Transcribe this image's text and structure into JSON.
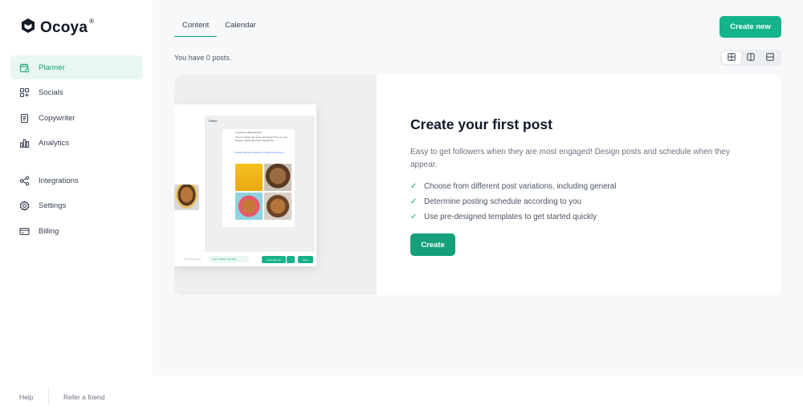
{
  "brand": {
    "name": "Ocoya",
    "registered": "®"
  },
  "sidebar": {
    "items": [
      {
        "label": "Planner",
        "icon": "calendar-icon",
        "active": true
      },
      {
        "label": "Socials",
        "icon": "grid-plus-icon"
      },
      {
        "label": "Copywriter",
        "icon": "document-icon"
      },
      {
        "label": "Analytics",
        "icon": "bar-chart-icon"
      },
      {
        "label": "Integrations",
        "icon": "share-icon"
      },
      {
        "label": "Settings",
        "icon": "gear-icon"
      },
      {
        "label": "Billing",
        "icon": "credit-card-icon"
      }
    ]
  },
  "header": {
    "tabs": [
      {
        "label": "Content",
        "active": true
      },
      {
        "label": "Calendar"
      }
    ],
    "create_new_label": "Create new",
    "posts_count": "You have 0 posts."
  },
  "view_toggle": {
    "options": [
      {
        "icon": "grid-view-icon",
        "active": true
      },
      {
        "icon": "columns-view-icon"
      },
      {
        "icon": "rows-view-icon"
      }
    ]
  },
  "empty_state": {
    "title": "Create your first post",
    "description": "Easy to get followers when they are most engaged! Design posts and schedule when they appear.",
    "checks": [
      "Choose from different post variations, including general",
      "Determine posting schedule according to you",
      "Use pre-designed templates to get started quickly"
    ],
    "create_label": "Create"
  },
  "mockup": {
    "network": "Twitter",
    "handle": "ocoya.com @ocoya.com",
    "text": "Tired of eating the same old burger? Try our new burgers made with fresh ingredients.",
    "tags": "#fresh #burgers #foodporn #delicious #burger",
    "date": "Apr 5, 2023, 3:33 PM",
    "schedule": "Schedule (4)",
    "save": "Save",
    "utc": "UTC (GMT+00)"
  },
  "footer": {
    "help": "Help",
    "refer": "Refer a friend"
  },
  "colors": {
    "accent": "#14b38a",
    "active_bg": "#e8f7f1",
    "main_bg": "#f7f8fa"
  }
}
